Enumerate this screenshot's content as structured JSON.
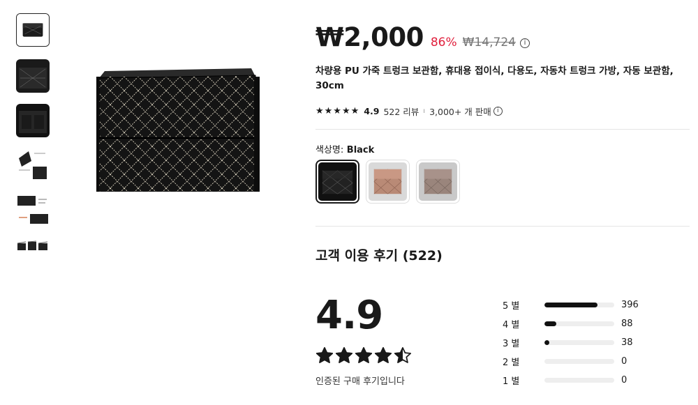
{
  "product": {
    "price": "₩2,000",
    "discount": "86%",
    "original_price": "₩14,724",
    "title": "차량용 PU 가죽 트렁크 보관함, 휴대용 접이식, 다용도, 자동차 트렁크 가방, 자동 보관함, 30cm",
    "rating_stars": "★★★★★",
    "rating": "4.9",
    "review_count": "522 리뷰",
    "separator": "ı",
    "sold": "3,000+ 개 판매",
    "info_glyph": "i"
  },
  "color": {
    "label": "색상명:",
    "value": "Black",
    "options": [
      {
        "name": "Black",
        "tone": "#1b1b1b"
      },
      {
        "name": "Brown",
        "tone": "#b98a76"
      },
      {
        "name": "Coffee",
        "tone": "#9a857c"
      }
    ]
  },
  "reviews": {
    "title": "고객 이용 후기 (522)",
    "average": "4.9",
    "average_value": 4.9,
    "verified": "인증된 구매 후기입니다",
    "distribution": [
      {
        "label": "5 별",
        "count": "396",
        "fraction": 0.76
      },
      {
        "label": "4 별",
        "count": "88",
        "fraction": 0.17
      },
      {
        "label": "3 별",
        "count": "38",
        "fraction": 0.07
      },
      {
        "label": "2 별",
        "count": "0",
        "fraction": 0
      },
      {
        "label": "1 별",
        "count": "0",
        "fraction": 0
      }
    ]
  },
  "thumbnails": [
    "box-front-icon",
    "box-detail-icon",
    "box-open-icon",
    "box-diagram-icon",
    "box-info-icon",
    "box-set-icon"
  ]
}
